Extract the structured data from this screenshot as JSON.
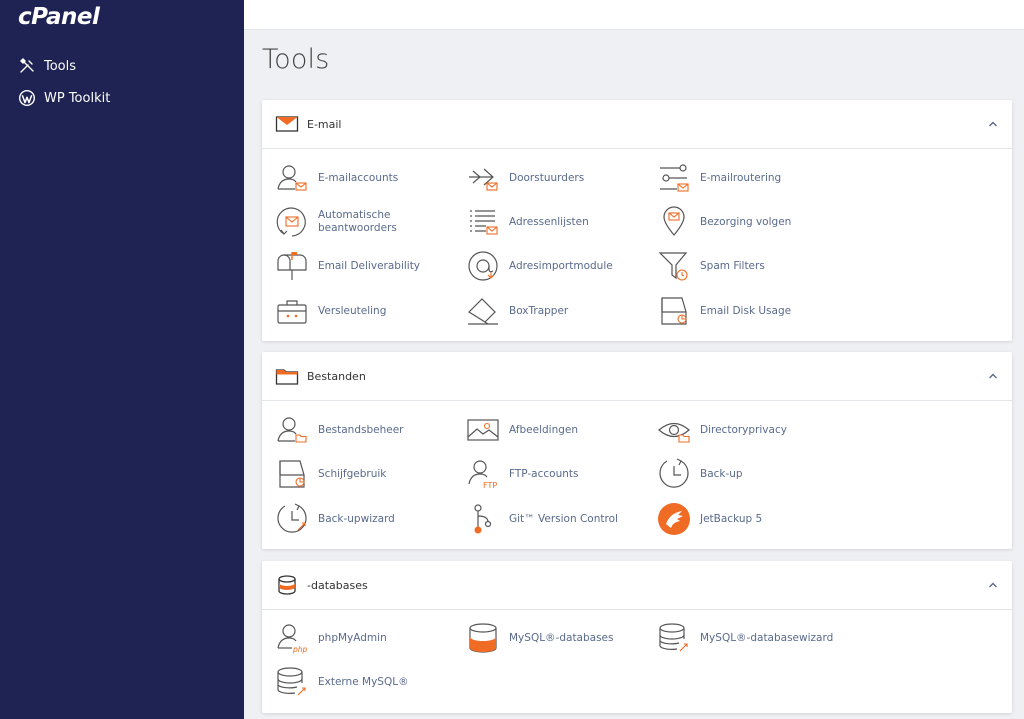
{
  "brand": {
    "logo": "cPanel"
  },
  "sidebar": {
    "items": [
      {
        "label": "Tools",
        "icon": "tools-icon"
      },
      {
        "label": "WP Toolkit",
        "icon": "wordpress-icon"
      }
    ]
  },
  "main": {
    "title": "Tools"
  },
  "colors": {
    "sidebar": "#1e2353",
    "accent": "#f06b24",
    "link": "#5a6a8c"
  },
  "sections": [
    {
      "title": "E-mail",
      "icon": "envelope-icon",
      "tools": [
        [
          "E-mailaccounts",
          "Doorstuurders",
          "E-mailroutering"
        ],
        [
          "Automatische beantwoorders",
          "Adressenlijsten",
          "Bezorging volgen"
        ],
        [
          "Email Deliverability",
          "Adresimportmodule",
          "Spam Filters"
        ],
        [
          "Versleuteling",
          "BoxTrapper",
          "Email Disk Usage"
        ]
      ]
    },
    {
      "title": "Bestanden",
      "icon": "folder-icon",
      "tools": [
        [
          "Bestandsbeheer",
          "Afbeeldingen",
          "Directoryprivacy"
        ],
        [
          "Schijfgebruik",
          "FTP-accounts",
          "Back-up"
        ],
        [
          "Back-upwizard",
          "Git™ Version Control",
          "JetBackup 5"
        ]
      ]
    },
    {
      "title": "-databases",
      "icon": "database-icon",
      "tools": [
        [
          "phpMyAdmin",
          "MySQL®-databases",
          "MySQL®-databasewizard"
        ],
        [
          "Externe MySQL®"
        ]
      ]
    }
  ]
}
